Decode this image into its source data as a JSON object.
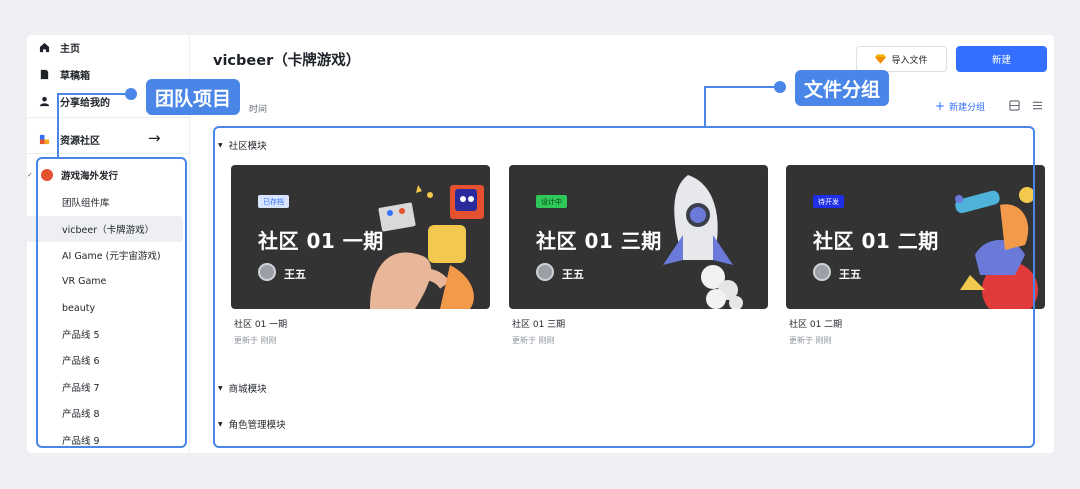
{
  "sidebar": {
    "nav": [
      {
        "label": "主页",
        "icon": "home-icon"
      },
      {
        "label": "草稿箱",
        "icon": "draft-icon"
      },
      {
        "label": "分享给我的",
        "icon": "user-icon"
      }
    ],
    "community": {
      "label": "资源社区",
      "icon": "community-icon",
      "arrow": "→"
    },
    "team_name": "游戏海外发行",
    "projects": [
      "团队组件库",
      "vicbeer（卡牌游戏）",
      "AI Game (元宇宙游戏)",
      "VR Game",
      "beauty",
      "产品线 5",
      "产品线 6",
      "产品线 7",
      "产品线 8",
      "产品线 9"
    ],
    "active_project_index": 1
  },
  "header": {
    "title": "vicbeer（卡牌游戏）",
    "import_label": "导入文件",
    "new_label": "新建",
    "sort_label": "时间",
    "new_group_label": "新建分组"
  },
  "sections": [
    {
      "label": "社区模块"
    },
    {
      "label": "商城模块"
    },
    {
      "label": "角色管理模块"
    }
  ],
  "cards": [
    {
      "badge": "已存档",
      "badge_bg": "#d9e4ff",
      "badge_fg": "#3370ff",
      "thumb_title": "社区 01 一期",
      "owner": "王五",
      "name": "社区 01 一期",
      "updated": "更新于 刚刚"
    },
    {
      "badge": "设计中",
      "badge_bg": "#2fc95a",
      "badge_fg": "#0b3d17",
      "thumb_title": "社区 01 三期",
      "owner": "王五",
      "name": "社区 01 三期",
      "updated": "更新于 刚刚"
    },
    {
      "badge": "待开发",
      "badge_bg": "#1f2fe8",
      "badge_fg": "#ffffff",
      "thumb_title": "社区 01 二期",
      "owner": "王五",
      "name": "社区 01 二期",
      "updated": "更新于 刚刚"
    }
  ],
  "annotations": {
    "team_projects": "团队项目",
    "file_groups": "文件分组"
  },
  "colors": {
    "accent": "#3370ff",
    "annotation": "#4a86e8",
    "team_dot": "#e5502f"
  }
}
